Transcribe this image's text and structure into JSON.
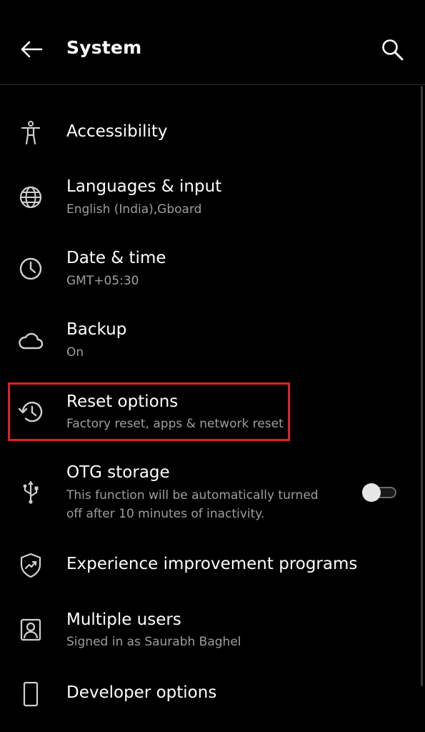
{
  "header": {
    "title": "System"
  },
  "items": [
    {
      "label": "Accessibility",
      "summary": ""
    },
    {
      "label": "Languages & input",
      "summary": "English (India),Gboard"
    },
    {
      "label": "Date & time",
      "summary": "GMT+05:30"
    },
    {
      "label": "Backup",
      "summary": "On"
    },
    {
      "label": "Reset options",
      "summary": "Factory reset, apps & network reset"
    },
    {
      "label": "OTG storage",
      "summary_line1": "This function will be automatically turned",
      "summary_line2": "off after 10 minutes of inactivity.",
      "toggle_on": false
    },
    {
      "label": "Experience improvement programs",
      "summary": ""
    },
    {
      "label": "Multiple users",
      "summary": "Signed in as Saurabh Baghel"
    },
    {
      "label": "Developer options",
      "summary": ""
    }
  ],
  "colors": {
    "background": "#000000",
    "text_primary": "#ffffff",
    "text_secondary": "#9e9e9e",
    "highlight": "#e02020"
  },
  "icons": {
    "back": "arrow-back-icon",
    "search": "search-icon",
    "accessibility": "accessibility-icon",
    "languages": "globe-icon",
    "date_time": "clock-icon",
    "backup": "cloud-icon",
    "reset": "history-icon",
    "otg": "usb-icon",
    "experience": "shield-chart-icon",
    "users": "user-icon",
    "developer": "phone-icon"
  }
}
